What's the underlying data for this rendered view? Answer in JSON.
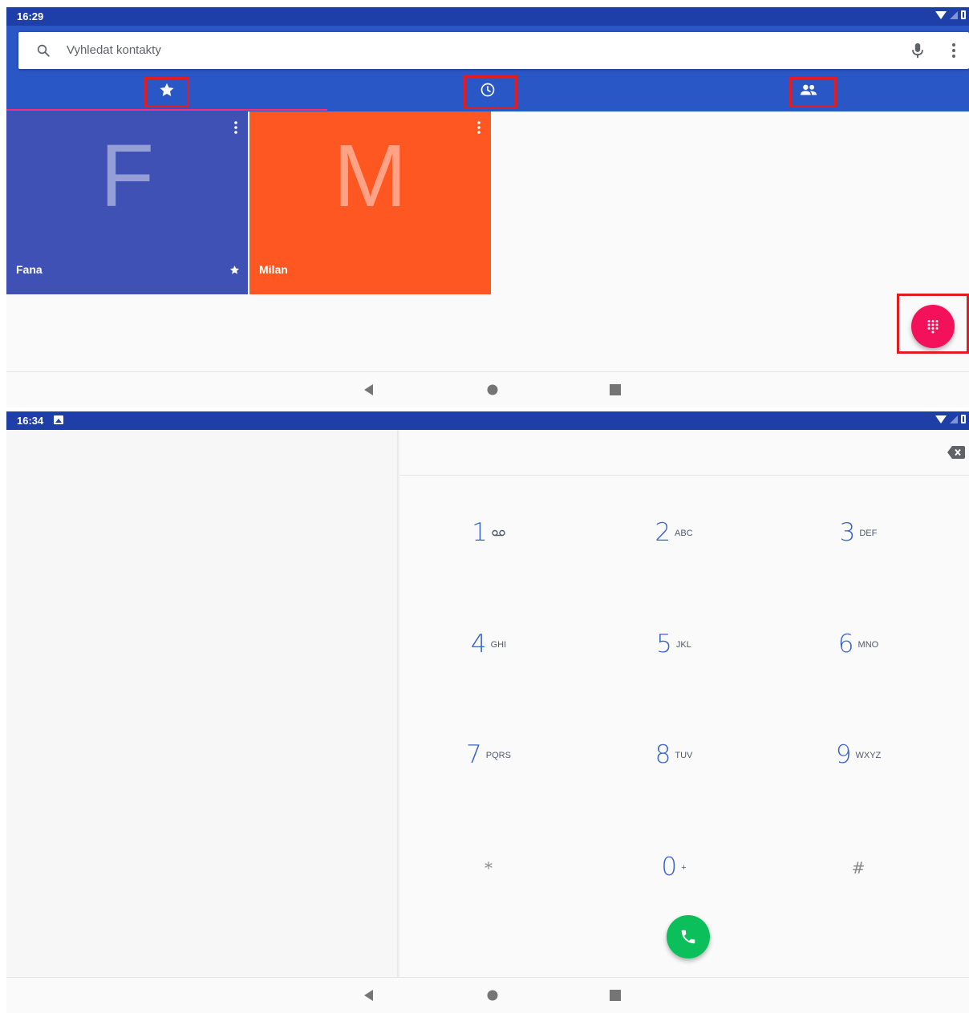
{
  "screen1": {
    "status_time": "16:29",
    "search": {
      "placeholder": "Vyhledat kontakty"
    },
    "tabs": [
      {
        "name": "favorites",
        "icon": "star-icon"
      },
      {
        "name": "recents",
        "icon": "clock-icon"
      },
      {
        "name": "contacts",
        "icon": "people-icon"
      }
    ],
    "favorites": [
      {
        "initial": "F",
        "name": "Fana",
        "color": "#3f51b5",
        "starred": true
      },
      {
        "initial": "M",
        "name": "Milan",
        "color": "#ff5722",
        "starred": false
      }
    ],
    "fab_icon": "dialpad-icon",
    "fab_color": "#f4115b",
    "accent_color": "#2a57c6",
    "status_color": "#1e3ea8"
  },
  "screen2": {
    "status_time": "16:34",
    "dialpad": [
      {
        "num": "1",
        "letters": "",
        "icon": "voicemail-icon"
      },
      {
        "num": "2",
        "letters": "ABC"
      },
      {
        "num": "3",
        "letters": "DEF"
      },
      {
        "num": "4",
        "letters": "GHI"
      },
      {
        "num": "5",
        "letters": "JKL"
      },
      {
        "num": "6",
        "letters": "MNO"
      },
      {
        "num": "7",
        "letters": "PQRS"
      },
      {
        "num": "8",
        "letters": "TUV"
      },
      {
        "num": "9",
        "letters": "WXYZ"
      },
      {
        "num": "*",
        "letters": ""
      },
      {
        "num": "0",
        "letters": "+"
      },
      {
        "num": "#",
        "letters": ""
      }
    ],
    "call_button_color": "#0bc05a",
    "digit_color": "#3763c8"
  }
}
